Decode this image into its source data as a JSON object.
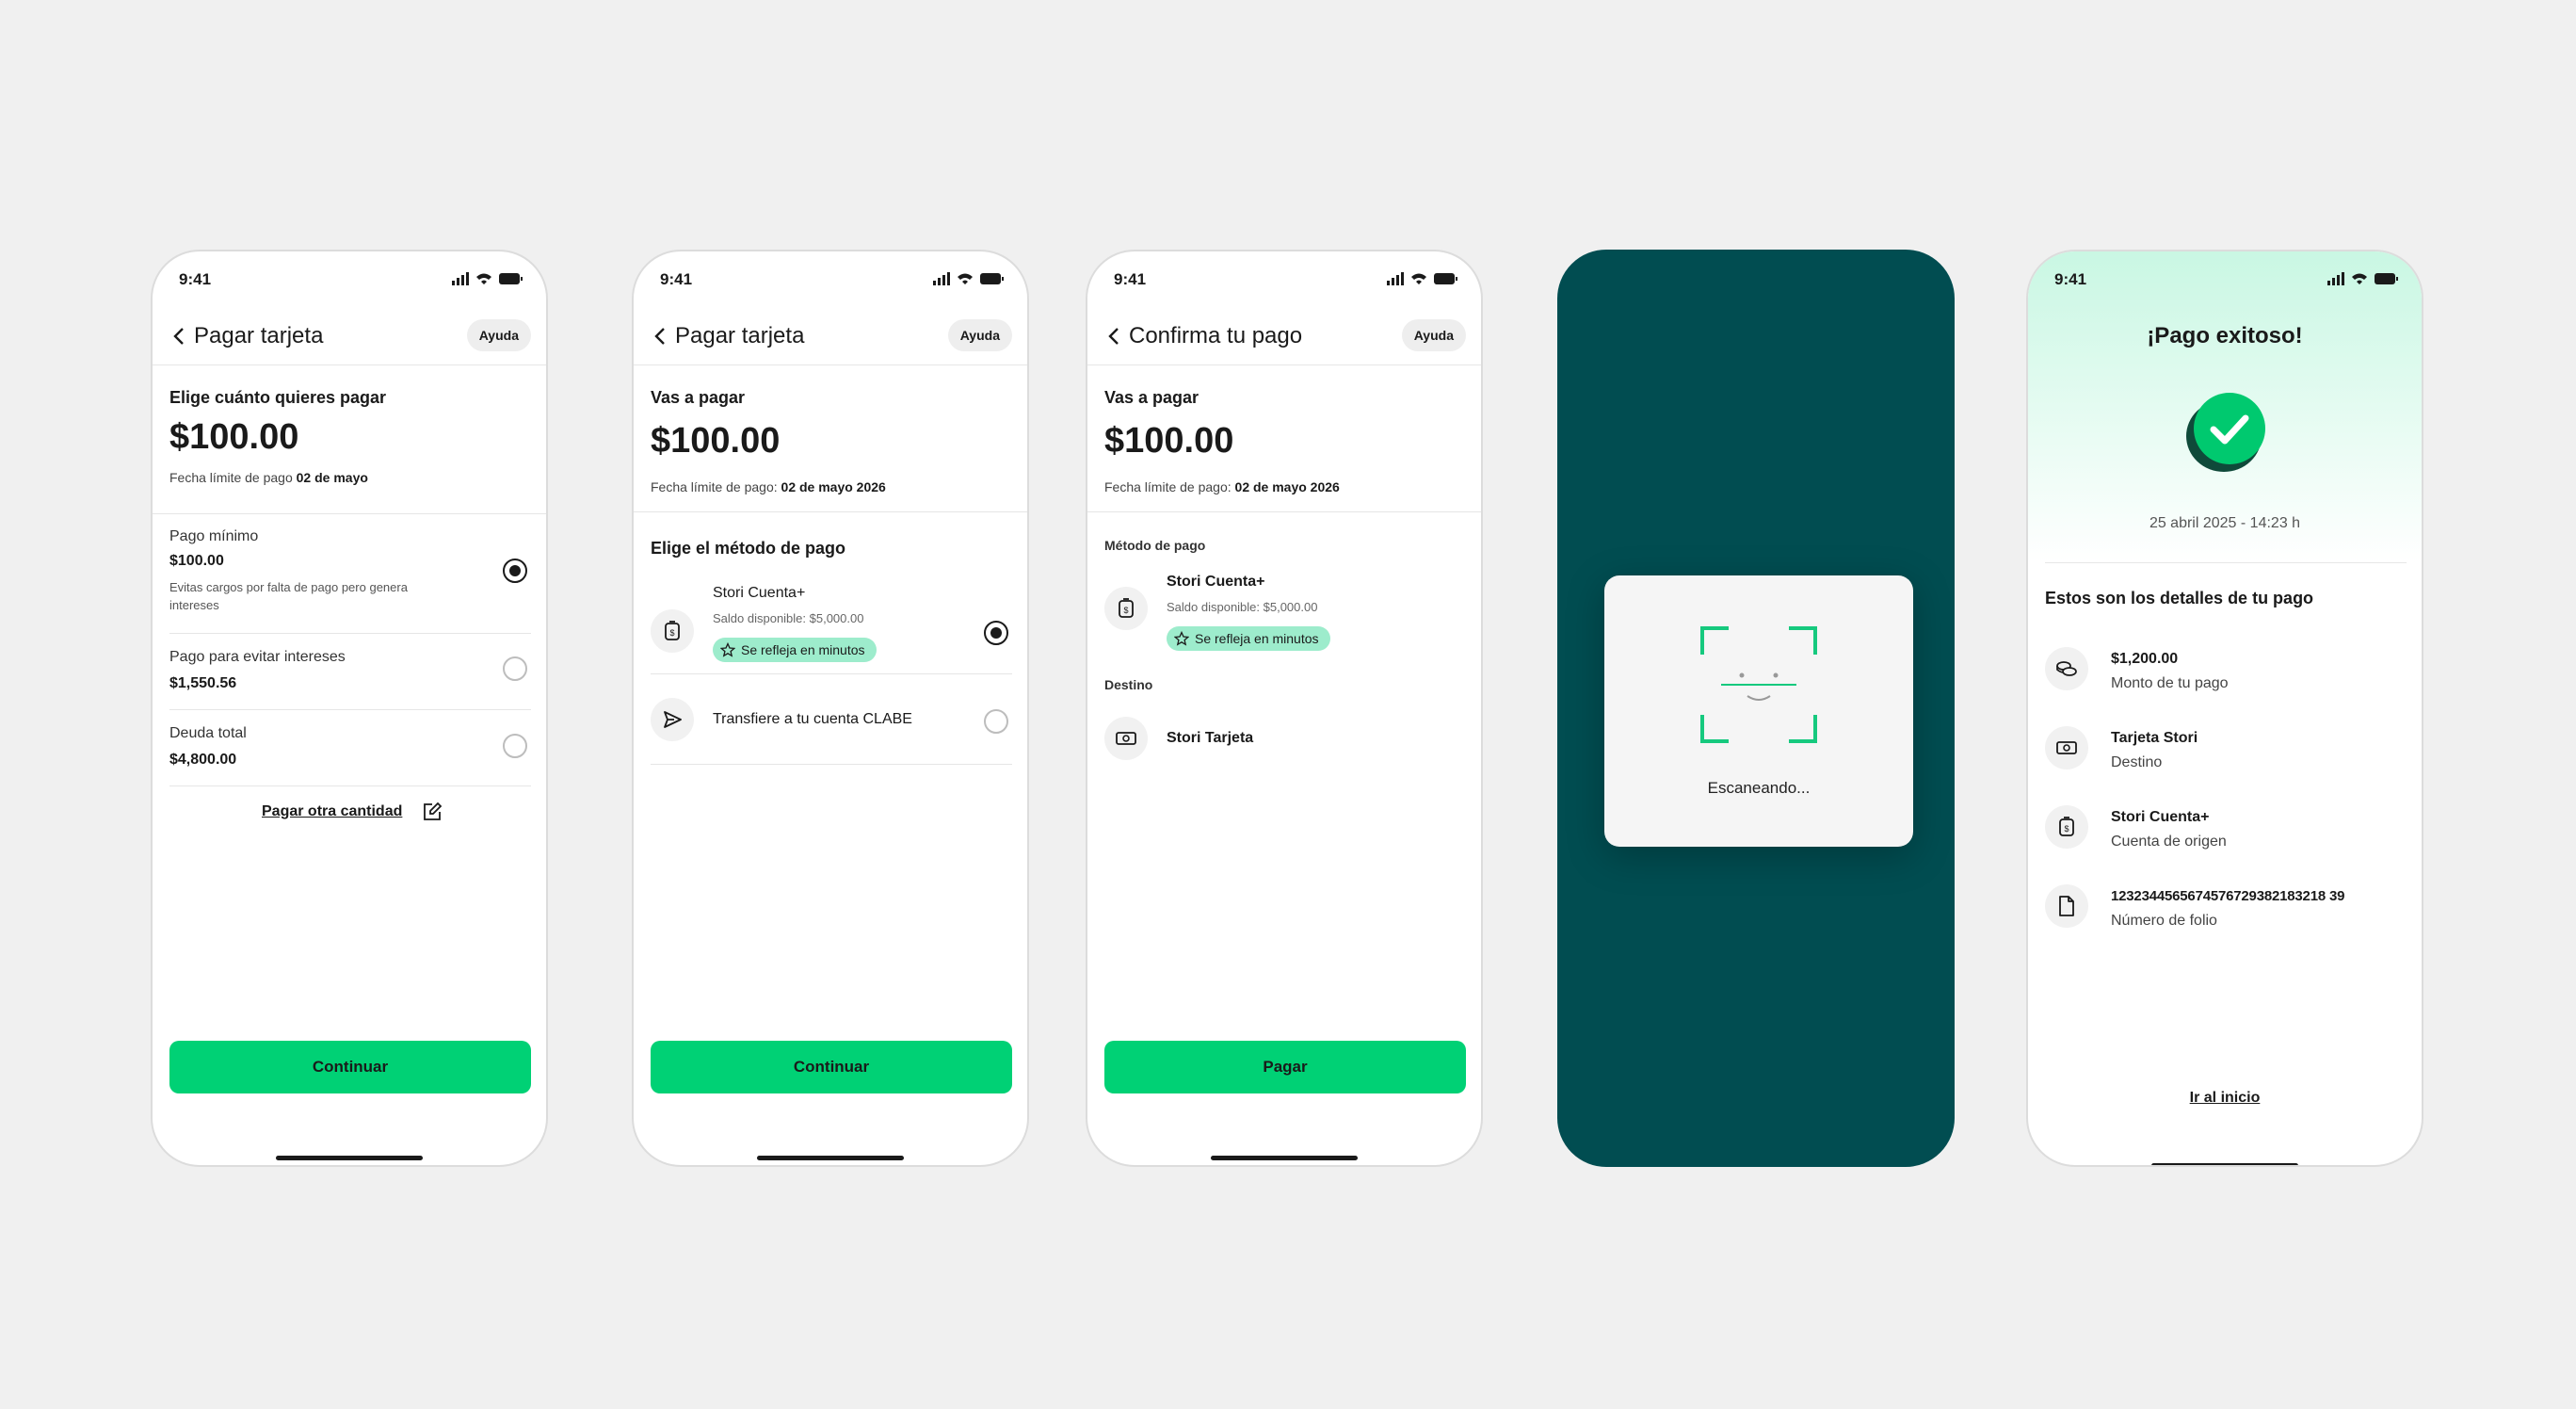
{
  "status": {
    "time": "9:41"
  },
  "screen1": {
    "title": "Pagar tarjeta",
    "help": "Ayuda",
    "section": "Elige cuánto quieres pagar",
    "amount": "$100.00",
    "due_label": "Fecha límite de pago",
    "due_date": "02 de mayo",
    "options": [
      {
        "label": "Pago mínimo",
        "value": "$100.00",
        "desc": "Evitas cargos por falta de pago pero genera intereses",
        "selected": true
      },
      {
        "label": "Pago para evitar intereses",
        "value": "$1,550.56",
        "selected": false
      },
      {
        "label": "Deuda total",
        "value": "$4,800.00",
        "selected": false
      }
    ],
    "other_amount": "Pagar otra cantidad",
    "cta": "Continuar"
  },
  "screen2": {
    "title": "Pagar tarjeta",
    "help": "Ayuda",
    "section": "Vas a pagar",
    "amount": "$100.00",
    "due_label": "Fecha límite de pago:",
    "due_date": "02 de mayo 2026",
    "method_title": "Elige el método de pago",
    "methods": [
      {
        "name": "Stori Cuenta+",
        "balance": "Saldo disponible: $5,000.00",
        "badge": "Se refleja en minutos",
        "selected": true
      },
      {
        "name": "Transfiere a tu cuenta CLABE",
        "selected": false
      }
    ],
    "cta": "Continuar"
  },
  "screen3": {
    "title": "Confirma tu pago",
    "help": "Ayuda",
    "section": "Vas a pagar",
    "amount": "$100.00",
    "due_label": "Fecha límite de pago:",
    "due_date": "02 de mayo 2026",
    "method_label": "Método de pago",
    "method_name": "Stori Cuenta+",
    "method_balance": "Saldo disponible: $5,000.00",
    "method_badge": "Se refleja en minutos",
    "dest_label": "Destino",
    "dest_name": "Stori Tarjeta",
    "cta": "Pagar"
  },
  "screen4": {
    "scan_text": "Escaneando..."
  },
  "screen5": {
    "title": "¡Pago exitoso!",
    "date": "25 abril 2025 - 14:23 h",
    "details_title": "Estos son los detalles de tu pago",
    "details": [
      {
        "icon": "coins-icon",
        "main": "$1,200.00",
        "sub": "Monto de tu pago"
      },
      {
        "icon": "card-icon",
        "main": "Tarjeta Stori",
        "sub": "Destino"
      },
      {
        "icon": "wallet-icon",
        "main": "Stori Cuenta+",
        "sub": "Cuenta de origen"
      },
      {
        "icon": "document-icon",
        "main": "1232344565674576729382183218 39",
        "sub": "Número de folio"
      }
    ],
    "home_link": "Ir al inicio"
  },
  "colors": {
    "accent": "#00d175",
    "dark_teal": "#014d51",
    "badge": "#9deccc",
    "scan_frame": "#16c97e"
  }
}
